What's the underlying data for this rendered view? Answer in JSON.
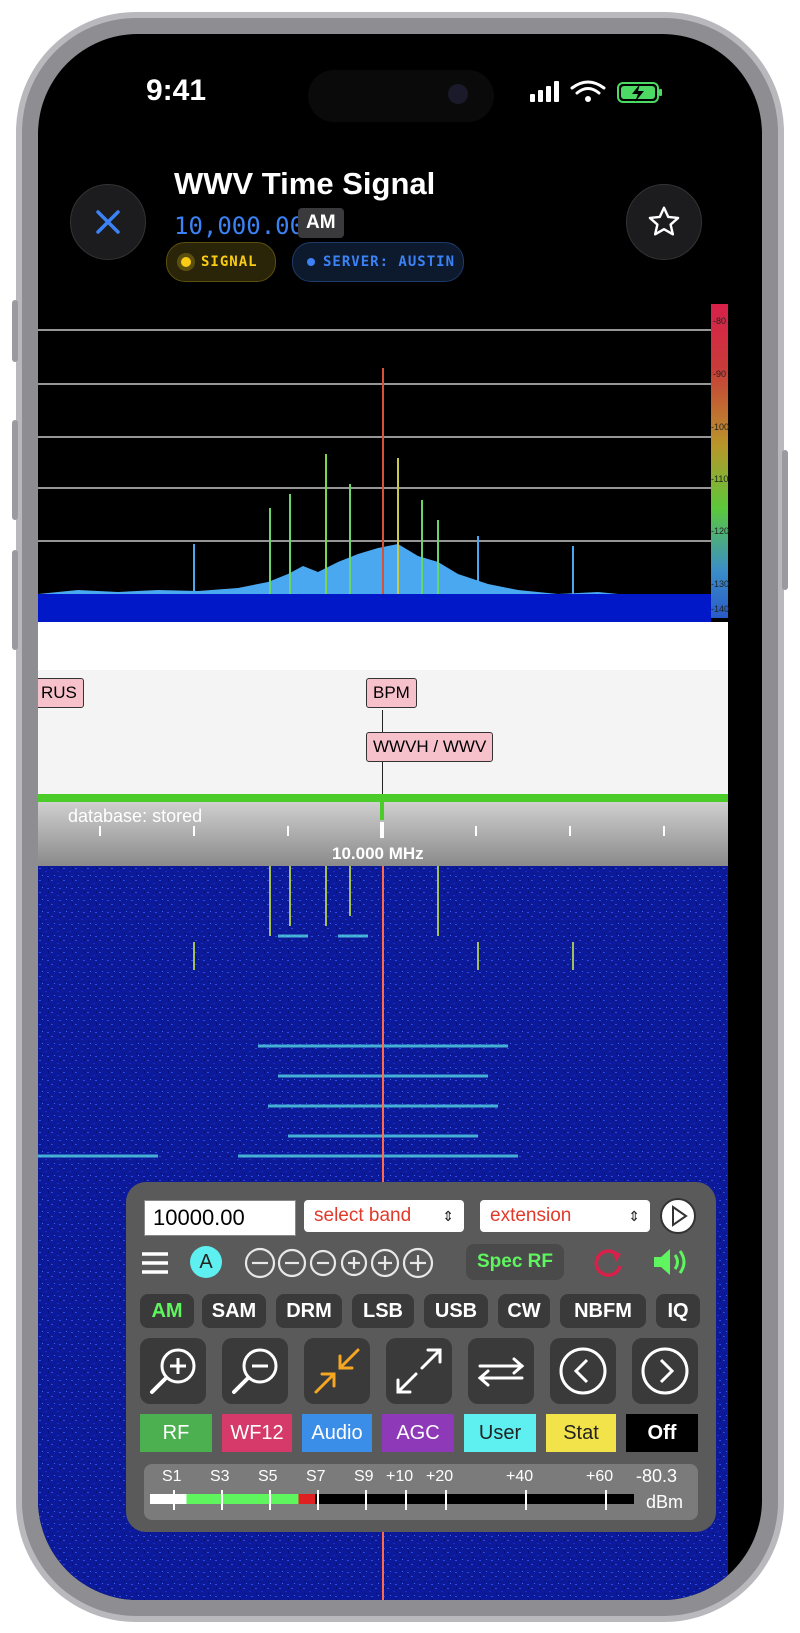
{
  "status": {
    "time": "9:41"
  },
  "header": {
    "title": "WWV Time Signal",
    "frequency": "10,000.00",
    "mode": "AM",
    "signal_pill": "SIGNAL",
    "server_pill": "SERVER: AUSTIN"
  },
  "spectrum": {
    "db_scale": [
      "-80",
      "-90",
      "-100",
      "-110",
      "-120",
      "-130",
      "-140"
    ]
  },
  "stations": {
    "rus": "RUS",
    "bpm": "BPM",
    "wwv": "WWVH / WWV"
  },
  "scale": {
    "database": "database: stored",
    "center": "10.000 MHz"
  },
  "controls": {
    "freq_value": "10000.00",
    "band_select": "select band",
    "extension_select": "extension",
    "a_label": "A",
    "spec_label": "Spec RF",
    "modes": [
      "AM",
      "SAM",
      "DRM",
      "LSB",
      "USB",
      "CW",
      "NBFM",
      "IQ"
    ],
    "tabs": [
      "RF",
      "WF12",
      "Audio",
      "AGC",
      "User",
      "Stat",
      "Off"
    ],
    "meter_labels": [
      "S1",
      "S3",
      "S5",
      "S7",
      "S9",
      "+10",
      "+20",
      "+40",
      "+60"
    ],
    "meter_value": "-80.3",
    "meter_unit": "dBm",
    "meter_level": 0.34
  },
  "colors": {
    "accent_blue": "#3b82f6",
    "signal_yellow": "#facc15",
    "spec_green": "#5ef55e",
    "tab_colors": [
      "#4caf50",
      "#d63a6a",
      "#3b8ee8",
      "#8e3ab8",
      "#5ef0f0",
      "#f2e34a",
      "#000000"
    ]
  }
}
